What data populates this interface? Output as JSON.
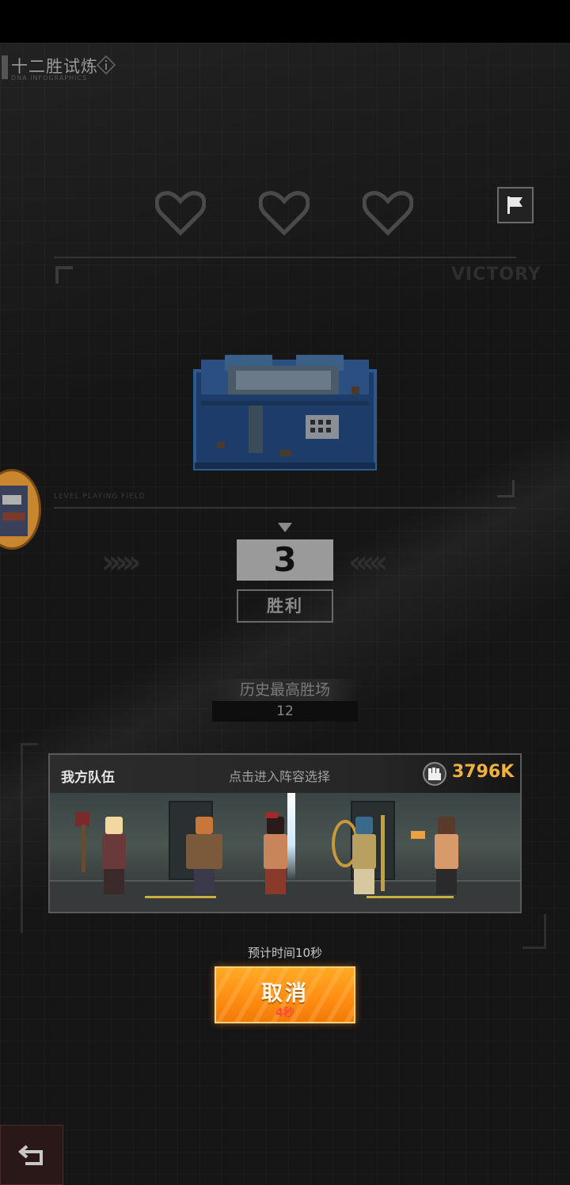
{
  "header": {
    "title": "十二胜试炼",
    "subtitle": "DNA INFOGRAPHICS"
  },
  "lives": {
    "total": 3,
    "icon": "heart-icon"
  },
  "banner": {
    "victory_label": "VICTORY",
    "level_label": "LEVEL PLAYING FIELD"
  },
  "result": {
    "wins": "3",
    "wins_label": "胜利",
    "best_label": "历史最高胜场",
    "best_value": "12"
  },
  "team": {
    "title": "我方队伍",
    "hint": "点击进入阵容选择",
    "power": "3796K"
  },
  "matching": {
    "eta_text": "预计时间10秒",
    "cancel_label": "取消",
    "countdown": "4秒"
  },
  "colors": {
    "accent": "#ff8c12",
    "power": "#f0b040",
    "countdown": "#ff4a3a"
  }
}
